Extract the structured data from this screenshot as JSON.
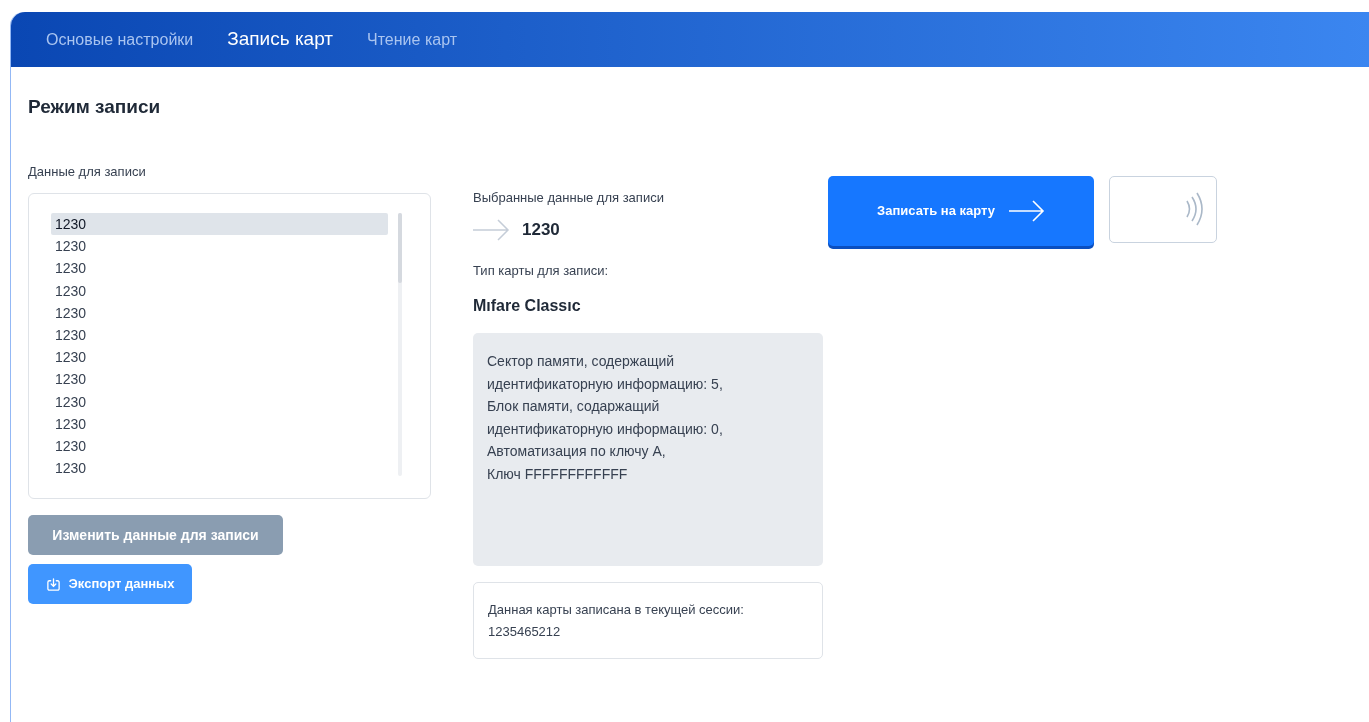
{
  "tabs": [
    {
      "label": "Основые настройки",
      "selected": false
    },
    {
      "label": "Запись карт",
      "selected": true
    },
    {
      "label": "Чтение карт",
      "selected": false
    }
  ],
  "title": "Режим записи",
  "data_list": {
    "label": "Данные для записи",
    "items": [
      {
        "text": "1230",
        "selected": true
      },
      {
        "text": "1230",
        "selected": false
      },
      {
        "text": "1230",
        "selected": false
      },
      {
        "text": "1230",
        "selected": false
      },
      {
        "text": "1230",
        "selected": false
      },
      {
        "text": "1230",
        "selected": false
      },
      {
        "text": "1230",
        "selected": false
      },
      {
        "text": "1230",
        "selected": false
      },
      {
        "text": "1230",
        "selected": false
      },
      {
        "text": "1230",
        "selected": false
      },
      {
        "text": "1230",
        "selected": false
      },
      {
        "text": "1230",
        "selected": false
      }
    ]
  },
  "change_button": {
    "label": "Изменить данные для записи",
    "disabled": true
  },
  "export_button": {
    "label": "Экспорт данных"
  },
  "selected_data": {
    "label": "Выбранные данные для записи",
    "value": "1230"
  },
  "card_type": {
    "label": "Тип карты для записи:",
    "value": "Mıfare Classıc"
  },
  "card_info": "Сектор памяти, содержащий\nидентификаторную информацию: 5,\nБлок памяти, содаржащий\nидентификаторную информацию: 0,\nАвтоматизация по ключу А,\nКлюч FFFFFFFFFFFF",
  "session": {
    "label": "Данная карты записана в текущей сессии:",
    "value": "1235465212"
  },
  "write_button": {
    "label": "Записать на карту"
  }
}
